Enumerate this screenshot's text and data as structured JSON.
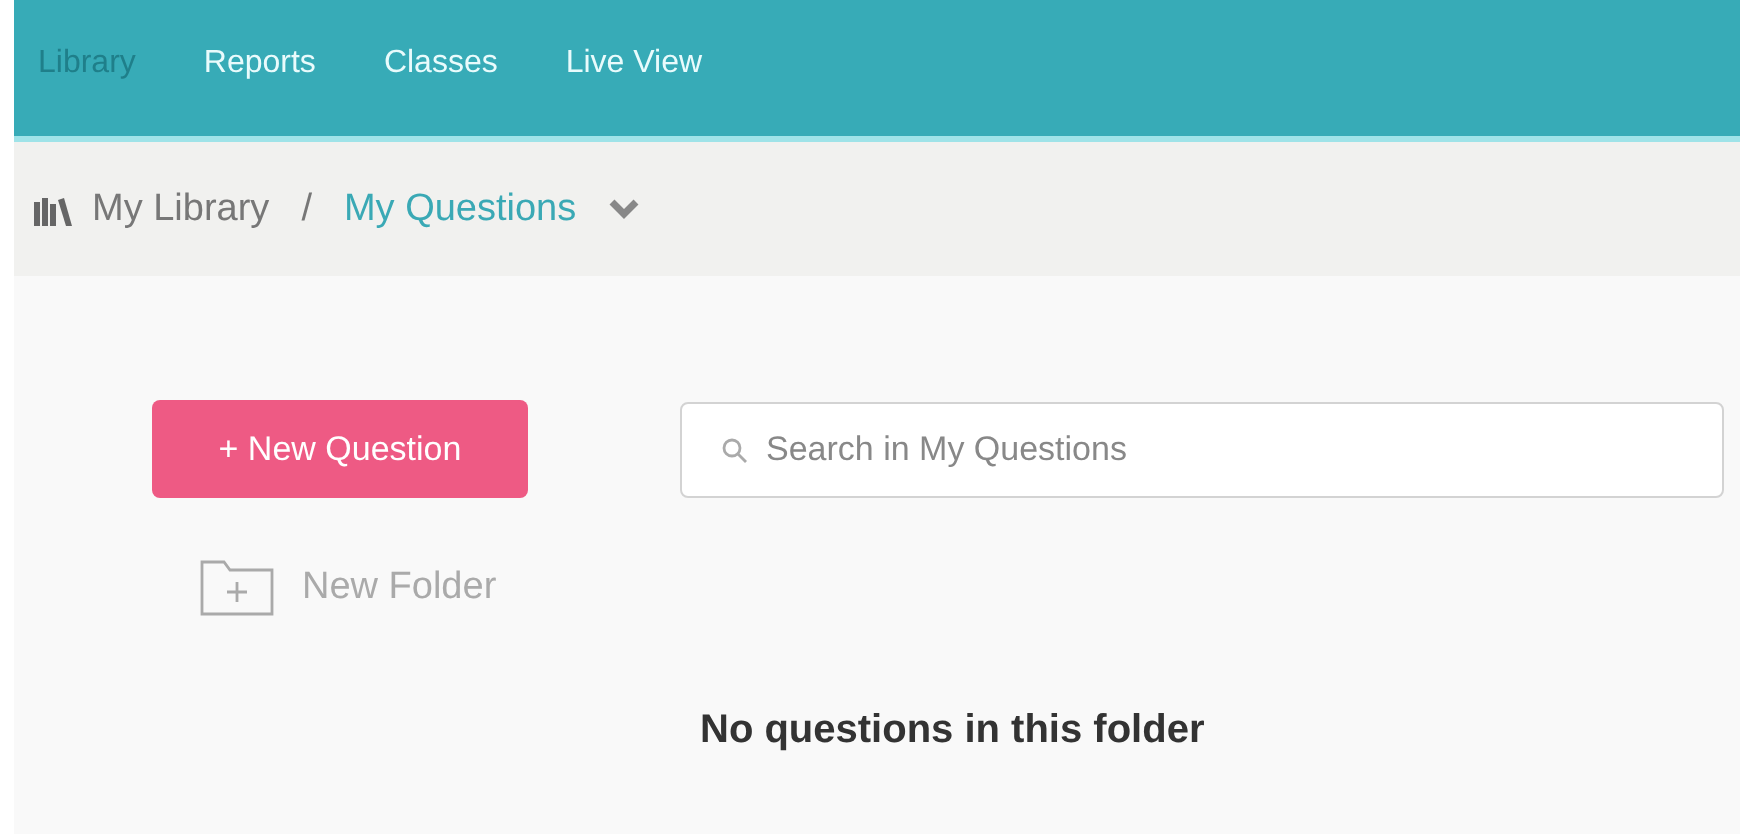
{
  "nav": {
    "tabs": [
      {
        "label": "Library",
        "selected": true
      },
      {
        "label": "Reports",
        "selected": false
      },
      {
        "label": "Classes",
        "selected": false
      },
      {
        "label": "Live View",
        "selected": false
      }
    ]
  },
  "breadcrumb": {
    "items": [
      {
        "label": "My Library",
        "selected": false
      },
      {
        "label": "My Questions",
        "selected": true
      }
    ],
    "separator": "/"
  },
  "actions": {
    "new_question": "+ New Question",
    "search": {
      "placeholder": "Search in My Questions"
    },
    "new_folder": "New Folder"
  },
  "empty_message": "No questions in this folder"
}
